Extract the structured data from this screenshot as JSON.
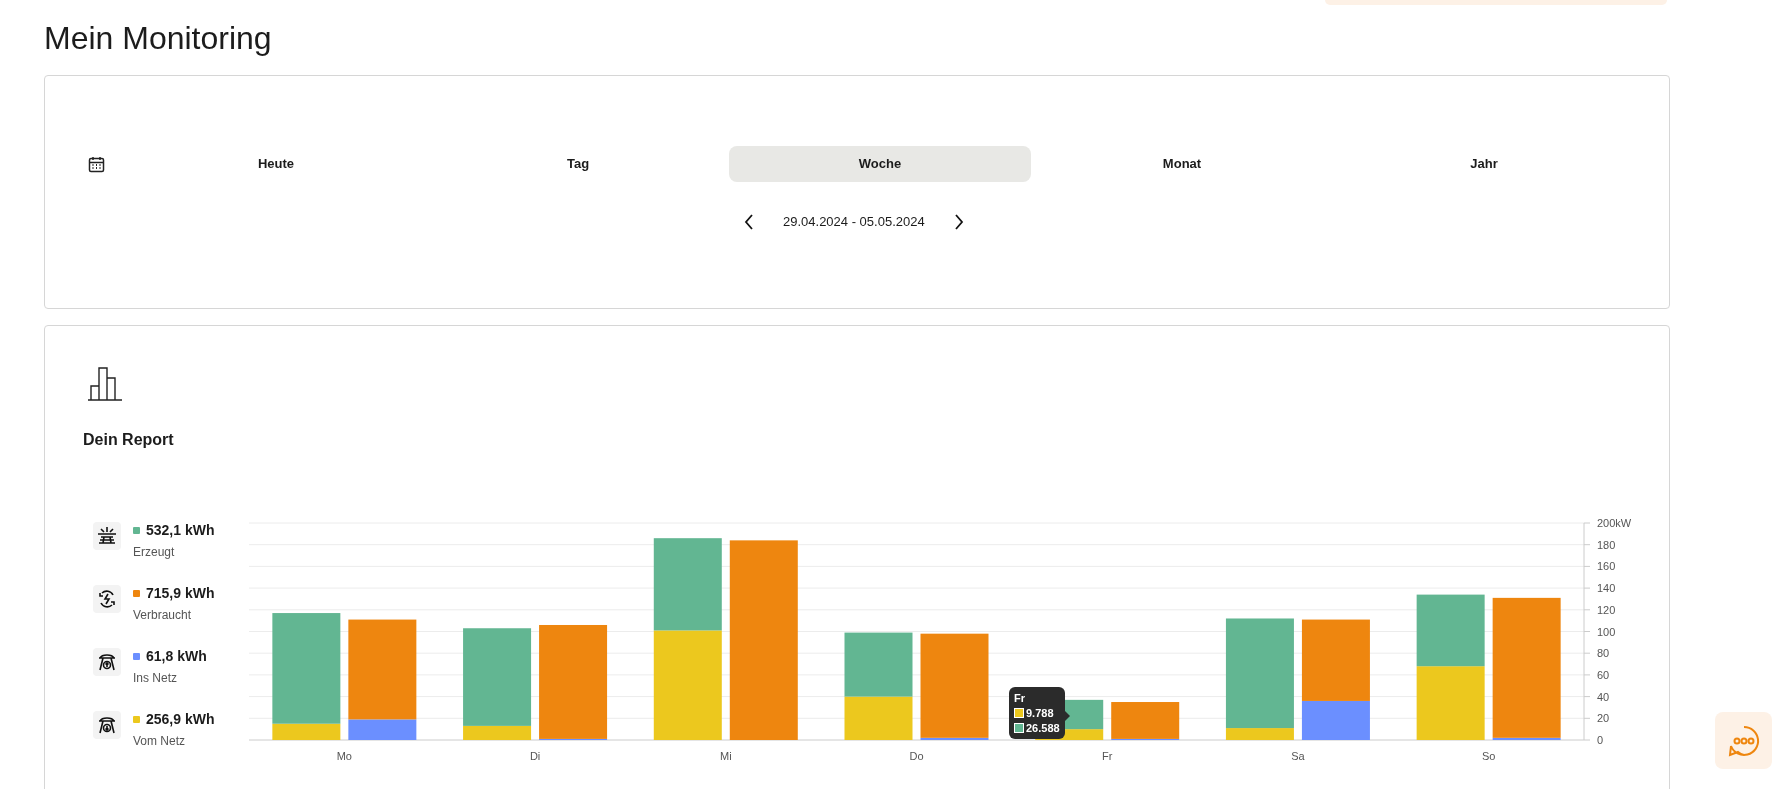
{
  "page_title": "Mein Monitoring",
  "period_tabs": [
    {
      "label": "Heute",
      "selected": false
    },
    {
      "label": "Tag",
      "selected": false
    },
    {
      "label": "Woche",
      "selected": true
    },
    {
      "label": "Monat",
      "selected": false
    },
    {
      "label": "Jahr",
      "selected": false
    }
  ],
  "date_range": "29.04.2024 - 05.05.2024",
  "report": {
    "title": "Dein Report",
    "legend": [
      {
        "kind": "solar",
        "color": "#62b692",
        "value": "532,1 kWh",
        "label": "Erzeugt"
      },
      {
        "kind": "consumption",
        "color": "#ee860f",
        "value": "715,9 kWh",
        "label": "Verbraucht"
      },
      {
        "kind": "grid_out",
        "color": "#6b8fff",
        "value": "61,8 kWh",
        "label": "Ins Netz"
      },
      {
        "kind": "grid_in",
        "color": "#ecc81e",
        "value": "256,9 kWh",
        "label": "Vom Netz"
      }
    ],
    "charts": [
      {
        "chart_data": {
          "type": "bar",
          "stacked": true,
          "grid": true,
          "categories": [
            "Mo",
            "Di",
            "Mi",
            "Do",
            "Fr",
            "Sa",
            "So"
          ],
          "series": [
            {
              "color": "#ecc81e",
              "values": [
                15,
                13,
                101,
                40,
                10,
                11,
                68
              ]
            },
            {
              "color": "#62b692",
              "values": [
                102,
                90,
                85,
                59,
                27,
                101,
                66
              ]
            }
          ],
          "ylim": [
            0,
            200
          ],
          "yticks": [
            0,
            20,
            40,
            60,
            80,
            100,
            120,
            140,
            160,
            180,
            {
              "value": 200,
              "label": "200kW"
            }
          ]
        }
      },
      {
        "chart_data": {
          "type": "bar",
          "stacked": true,
          "series": [
            {
              "color": "#6b8fff",
              "values": [
                19,
                1,
                0,
                2,
                1,
                36,
                2
              ]
            },
            {
              "color": "#ee860f",
              "values": [
                92,
                105,
                184,
                96,
                34,
                75,
                129
              ]
            }
          ],
          "ylim": [
            0,
            200
          ]
        }
      }
    ],
    "tooltip": {
      "title": "Fr",
      "entries": [
        {
          "color": "#ecc81e",
          "value": "9.788"
        },
        {
          "color": "#62b692",
          "value": "26.588"
        }
      ]
    }
  }
}
